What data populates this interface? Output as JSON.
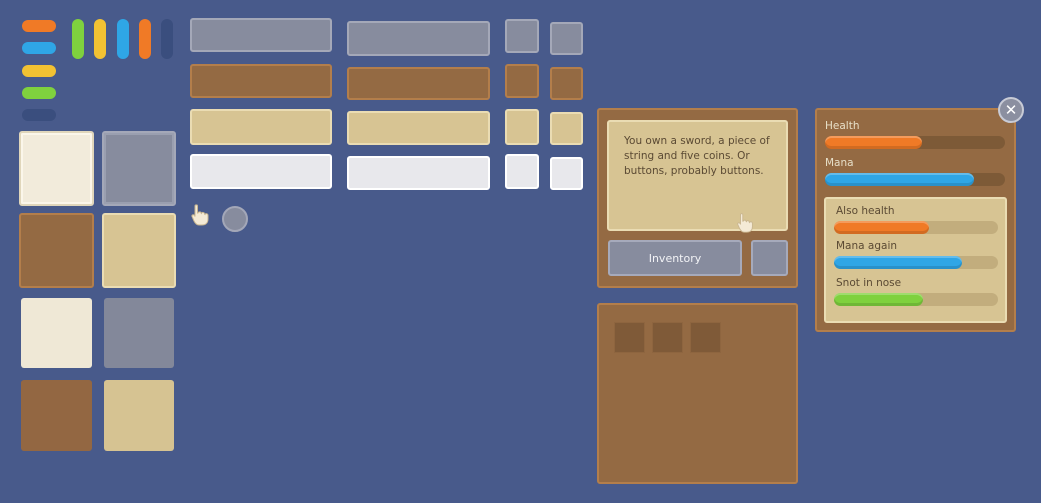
{
  "colors": {
    "background": "#485a8b",
    "orange": "#f07a26",
    "blue": "#2fa6e6",
    "yellow": "#f2c233",
    "green": "#7fd13e",
    "navy": "#3a4e7e",
    "brown": "#946a43",
    "tan": "#d7c493",
    "gray": "#878c9e",
    "cream": "#f2ebdb"
  },
  "icons": [
    "pointer-hand-icon",
    "circle-button-icon",
    "close-icon"
  ],
  "dialog": {
    "text": "You own a sword, a piece of string and five coins. Or buttons, probably buttons.",
    "inventory_label": "Inventory"
  },
  "stats_panel": {
    "close_label": "✕",
    "bars": [
      {
        "label": "Health",
        "value": 0.54,
        "color": "orange"
      },
      {
        "label": "Mana",
        "value": 0.83,
        "color": "blue"
      }
    ],
    "inner_bars": [
      {
        "label": "Also health",
        "value": 0.58,
        "color": "orange"
      },
      {
        "label": "Mana again",
        "value": 0.78,
        "color": "blue"
      },
      {
        "label": "Snot in nose",
        "value": 0.54,
        "color": "green"
      }
    ]
  }
}
